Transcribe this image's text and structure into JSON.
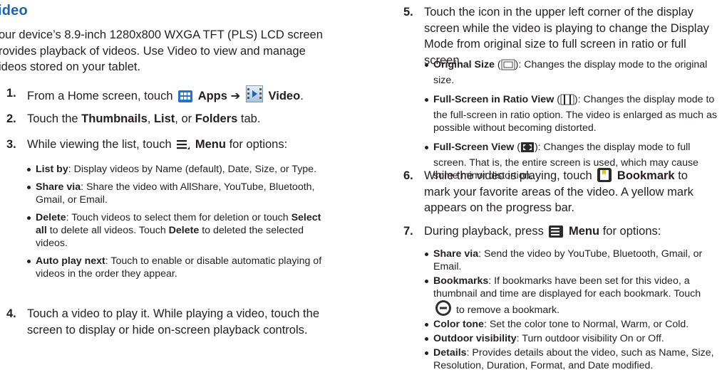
{
  "left": {
    "heading": "ideo",
    "intro": "our device’s 8.9-inch 1280x800 WXGA TFT (PLS) LCD screen rovides playback of videos. Use Video to view and manage ideos stored on your tablet.",
    "step1": {
      "num": "1.",
      "pre": "From a Home screen, touch",
      "apps": "Apps",
      "arrow": "➔",
      "video": "Video",
      "end": "."
    },
    "step2": {
      "num": "2.",
      "pre": "Touch the",
      "thumbnails": "Thumbnails",
      "sep1": ",",
      "list": "List",
      "sep2": ", or",
      "folders": "Folders",
      "end": "tab."
    },
    "step3": {
      "num": "3.",
      "pre": "While viewing the list, touch",
      "menu": "Menu",
      "end": "for options:",
      "bullets": [
        {
          "term": "List by",
          "text": ": Display videos by Name (default), Date, Size, or Type."
        },
        {
          "term": "Share via",
          "text": ": Share the video with AllShare, YouTube, Bluetooth, Gmail, or Email."
        },
        {
          "term": "Delete",
          "text": ": Touch videos to select them for deletion or touch ",
          "term2": "Select all",
          "text2": " to delete all videos. Touch ",
          "term3": "Delete",
          "text3": " to deleted the selected videos."
        },
        {
          "term": "Auto play next",
          "text": ": Touch to enable or disable automatic playing of videos in the order they appear."
        }
      ]
    },
    "step4": {
      "num": "4.",
      "text": "Touch a video to play it. While playing a video, touch the screen to display or hide on-screen playback controls."
    }
  },
  "right": {
    "step5": {
      "num": "5.",
      "text": "Touch the icon in the upper left corner of the display screen while the video is playing to change the Display Mode from original size to full screen in ratio or full screen.",
      "bullets": [
        {
          "term": "Original Size",
          "open": " (",
          "close": "): Changes the display mode to the original size."
        },
        {
          "term": "Full-Screen in Ratio View",
          "open": " (",
          "close": "): Changes the display mode to the full-screen in ratio option. The video is enlarged as much as possible without becoming distorted."
        },
        {
          "term": "Full-Screen View",
          "open": " (",
          "close": "): Changes the display mode to full screen. That is, the entire screen is used, which may cause some minor distortion."
        }
      ]
    },
    "step6": {
      "num": "6.",
      "pre": "While the video is playing, touch",
      "bookmark": "Bookmark",
      "post": "to mark your favorite areas of the video. A yellow mark appears on the progress bar."
    },
    "step7": {
      "num": "7.",
      "pre": "During playback, press",
      "menu": "Menu",
      "end": "for options:",
      "bullets": [
        {
          "term": "Share via",
          "text": ": Send the video by YouTube, Bluetooth, Gmail, or Email."
        },
        {
          "term": "Bookmarks",
          "text": ": If bookmarks have been set for this video, a thumbnail and time are displayed for each bookmark. Touch ",
          "text2": " to remove a bookmark."
        },
        {
          "term": "Color tone",
          "text": ": Set the color tone to Normal, Warm, or Cold."
        },
        {
          "term": "Outdoor visibility",
          "text": ": Turn outdoor visibility On or Off."
        },
        {
          "term": "Details",
          "text": ": Provides details about the video, such as Name, Size, Resolution, Duration, Format, and Date modified."
        }
      ]
    }
  },
  "icons": [
    "apps-icon",
    "video-app-icon",
    "menu-icon",
    "original-size-icon",
    "full-screen-ratio-icon",
    "full-screen-icon",
    "bookmark-icon",
    "menu-key-icon",
    "remove-bookmark-icon"
  ],
  "colors": {
    "heading": "#1d63ad",
    "text": "#231f20",
    "icon_blue": "#2474c9"
  }
}
